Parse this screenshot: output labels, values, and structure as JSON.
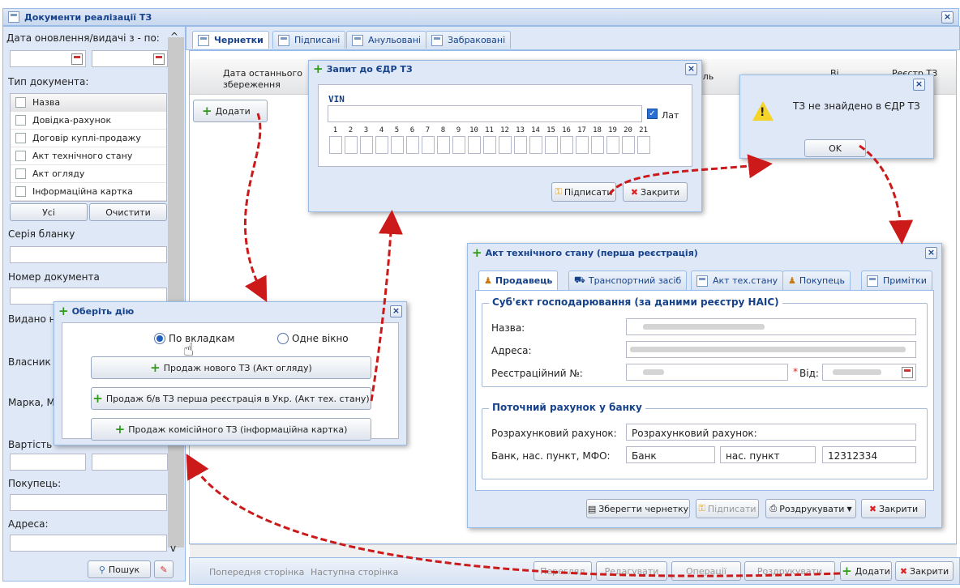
{
  "main": {
    "title": "Документи реалізації ТЗ"
  },
  "sidebar": {
    "date_label": "Дата оновлення/видачі з - по:",
    "doctype_label": "Тип документа:",
    "doctype_header": "Назва",
    "doctypes": [
      "Довідка-рахунок",
      "Договір куплі-продажу",
      "Акт технічного стану",
      "Акт огляду",
      "Інформаційна картка"
    ],
    "all_btn": "Усі",
    "clear_btn": "Очистити",
    "series_label": "Серія бланку",
    "docnum_label": "Номер документа",
    "issued_label": "Видано н",
    "owner_label": "Власник",
    "brand_label": "Марка, М",
    "cost_label": "Вартість",
    "buyer_label": "Покупець:",
    "address_label": "Адреса:",
    "search_btn": "Пошук"
  },
  "tabs": [
    "Чернетки",
    "Підписані",
    "Анульовані",
    "Забраковані"
  ],
  "grid": {
    "col1": "Дата останнього збереження",
    "col2": "ель",
    "col3": "Ві",
    "col4": "Реєстр ТЗ",
    "add_btn": "Додати"
  },
  "bottom": {
    "prev": "Попередня сторінка",
    "next": "Наступна сторінка",
    "b1": "Перегляд",
    "b2": "Редагувати",
    "b3": "Операції",
    "b4": "Роздрукувати",
    "add": "Додати",
    "close": "Закрити"
  },
  "edr": {
    "title": "Запит до ЄДР ТЗ",
    "vin_label": "VIN",
    "lat_label": "Лат",
    "digits": [
      "1",
      "2",
      "3",
      "4",
      "5",
      "6",
      "7",
      "8",
      "9",
      "10",
      "11",
      "12",
      "13",
      "14",
      "15",
      "16",
      "17",
      "18",
      "19",
      "20",
      "21"
    ],
    "sign_btn": "Підписати",
    "close_btn": "Закрити"
  },
  "msg": {
    "text": "ТЗ не знайдено в ЄДР ТЗ",
    "ok": "OK"
  },
  "action": {
    "title": "Оберіть дію",
    "opt1": "По вкладкам",
    "opt2": "Одне вікно",
    "b1": "Продаж нового ТЗ (Акт огляду)",
    "b2": "Продаж б/в ТЗ перша реєстрація в Укр. (Акт тех. стану)",
    "b3": "Продаж комісійного ТЗ (інформаційна картка)"
  },
  "act": {
    "title": "Акт технічного стану (перша реєстрація)",
    "tabs": [
      "Продавець",
      "Транспортний засіб",
      "Акт тех.стану",
      "Покупець",
      "Примітки"
    ],
    "legend1": "Суб'єкт господарювання (за даними реєстру НАІС)",
    "name_label": "Назва:",
    "addr_label": "Адреса:",
    "reg_label": "Реєстраційний №:",
    "from_label": "Від:",
    "legend2": "Поточний рахунок у банку",
    "acc_label": "Розрахунковий рахунок:",
    "acc_value": "Розрахунковий рахунок:",
    "bank_label": "Банк, нас. пункт, МФО:",
    "bank_value": "Банк",
    "city_value": "нас. пункт",
    "mfo_value": "12312334",
    "save_btn": "Зберегти чернетку",
    "sign_btn": "Підписати",
    "print_btn": "Роздрукувати",
    "close_btn": "Закрити"
  },
  "colors": {
    "accent": "#15428b",
    "arrow": "#cc1a1a",
    "panel": "#dfe8f6"
  }
}
